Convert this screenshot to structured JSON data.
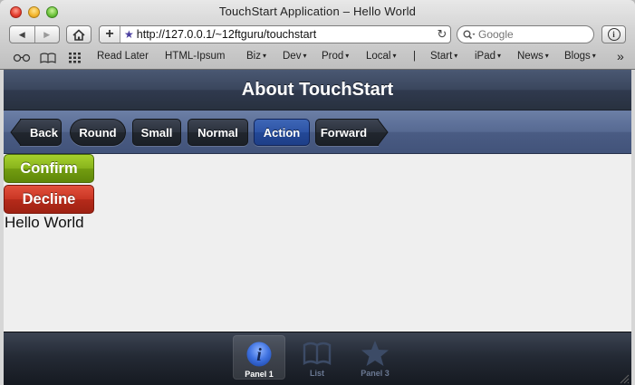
{
  "window": {
    "title": "TouchStart Application – Hello World"
  },
  "toolbar": {
    "back_icon": "◀",
    "forward_icon": "▶",
    "home_icon": "⌂",
    "add_bookmark_icon": "+",
    "favicon": "★",
    "url": "http://127.0.0.1/~12ftguru/touchstart",
    "reload_icon": "↻",
    "search_icon": "⌕",
    "search_placeholder": "Google",
    "info_icon": "i"
  },
  "bookmarks": {
    "items": [
      {
        "label": "Read Later",
        "has_menu": false
      },
      {
        "label": "HTML-Ipsum",
        "has_menu": false
      },
      {
        "label": "Biz",
        "has_menu": true
      },
      {
        "label": "Dev",
        "has_menu": true
      },
      {
        "label": "Prod",
        "has_menu": true
      },
      {
        "label": "Local",
        "has_menu": true
      },
      {
        "label": "|",
        "has_menu": false
      },
      {
        "label": "Start",
        "has_menu": true
      },
      {
        "label": "iPad",
        "has_menu": true
      },
      {
        "label": "News",
        "has_menu": true
      },
      {
        "label": "Blogs",
        "has_menu": true
      }
    ],
    "menu_arrow": "▾",
    "overflow": "»"
  },
  "app": {
    "title": "About TouchStart",
    "toolbar_buttons": {
      "back": "Back",
      "round": "Round",
      "small": "Small",
      "normal": "Normal",
      "action": "Action",
      "forward": "Forward"
    },
    "confirm_label": "Confirm",
    "decline_label": "Decline",
    "body_text": "Hello World",
    "tabs": {
      "panel1": {
        "label": "Panel 1",
        "icon": "i"
      },
      "list": {
        "label": "List"
      },
      "panel3": {
        "label": "Panel 3"
      }
    }
  },
  "colors": {
    "titlebar": "#333c4f",
    "toolbar": "#566992",
    "action_button": "#2d54a6",
    "confirm": "#88b31c",
    "decline": "#c93624",
    "tab_active_icon": "#4a7be0",
    "tab_inactive_icon": "#3c4b66"
  }
}
